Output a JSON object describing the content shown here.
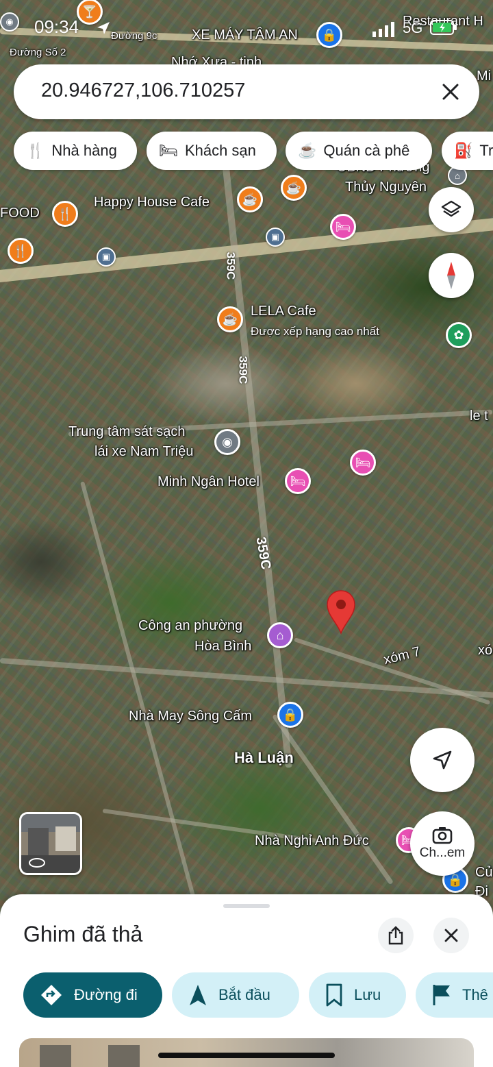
{
  "status_bar": {
    "time": "09:34",
    "network": "5G"
  },
  "search": {
    "query": "20.946727,106.710257"
  },
  "chips": [
    {
      "label": "Nhà hàng",
      "icon": "restaurant-icon"
    },
    {
      "label": "Khách sạn",
      "icon": "hotel-icon"
    },
    {
      "label": "Quán cà phê",
      "icon": "coffee-icon"
    },
    {
      "label": "Tr",
      "icon": "gas-station-icon"
    }
  ],
  "map": {
    "labels": {
      "duong_9c": "Đường 9c",
      "xe_may_tam_an": "XE MÁY TÂM AN",
      "duong_so_2": "Đường Số 2",
      "restaurant_h": "Restaurant H",
      "nho_xua": "Nhớ Xưa - tinh",
      "mi": "Mi",
      "ubnd": "UBND Phường",
      "thuy_nguyen": "Thủy Nguyên",
      "food": "FOOD",
      "happy_house": "Happy House Cafe",
      "road_359c_1": "359C",
      "road_359c_2": "359C",
      "road_359c_3": "359C",
      "lela": "LELA Cafe",
      "lela_rating": "Được xếp hạng cao nhất",
      "le_t": "le t",
      "trung_tam_1": "Trung tâm sát sạch",
      "trung_tam_2": "lái xe Nam Triệu",
      "minh_ngan": "Minh Ngân Hotel",
      "cong_an_1": "Công an phường",
      "cong_an_2": "Hòa Bình",
      "xom_7": "xóm 7",
      "xo": "xó",
      "nha_may": "Nhà May Sông Cấm",
      "ha_luan": "Hà Luận",
      "nha_nghi": "Nhà Nghỉ Anh Đức",
      "cu": "Củ",
      "di": "Đi"
    }
  },
  "camera_button": {
    "label": "Ch...em"
  },
  "sheet": {
    "title": "Ghim đã thả",
    "actions": [
      {
        "label": "Đường đi",
        "icon": "directions-icon"
      },
      {
        "label": "Bắt đầu",
        "icon": "navigation-arrow-icon"
      },
      {
        "label": "Lưu",
        "icon": "bookmark-icon"
      },
      {
        "label": "Thê",
        "icon": "flag-icon"
      }
    ]
  },
  "colors": {
    "primary_action": "#0b5f6e",
    "secondary_action": "#d3f0f7",
    "pin": "#e53935",
    "poi_orange": "#f07d1b",
    "poi_pink": "#e84fb3",
    "poi_blue": "#1a73e8"
  }
}
